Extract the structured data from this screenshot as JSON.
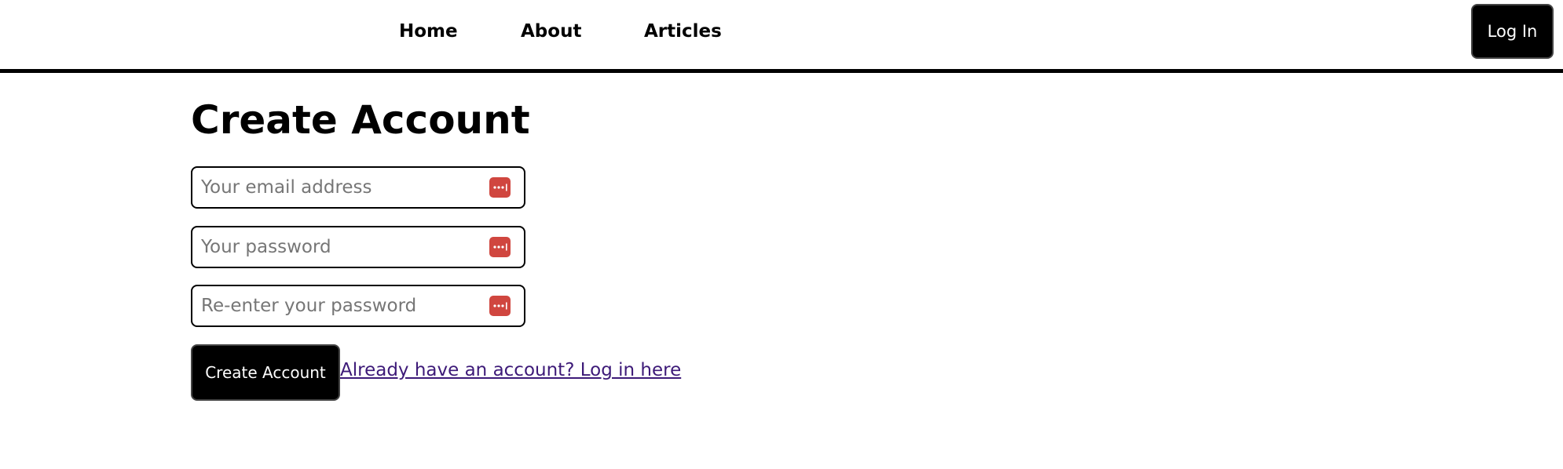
{
  "nav": {
    "links": [
      "Home",
      "About",
      "Articles"
    ],
    "login_label": "Log In"
  },
  "main": {
    "title": "Create Account",
    "email_placeholder": "Your email address",
    "password_placeholder": "Your password",
    "confirm_placeholder": "Re-enter your password",
    "password_manager_icon": "password-manager-icon",
    "submit_label": "Create Account",
    "login_link": "Already have an account? Log in here"
  },
  "colors": {
    "background": "#ffffff",
    "text": "#000000",
    "button_bg": "#000000",
    "button_text": "#ffffff",
    "icon_bg": "#d0463f",
    "link": "#3d1a78",
    "placeholder": "#767676"
  }
}
